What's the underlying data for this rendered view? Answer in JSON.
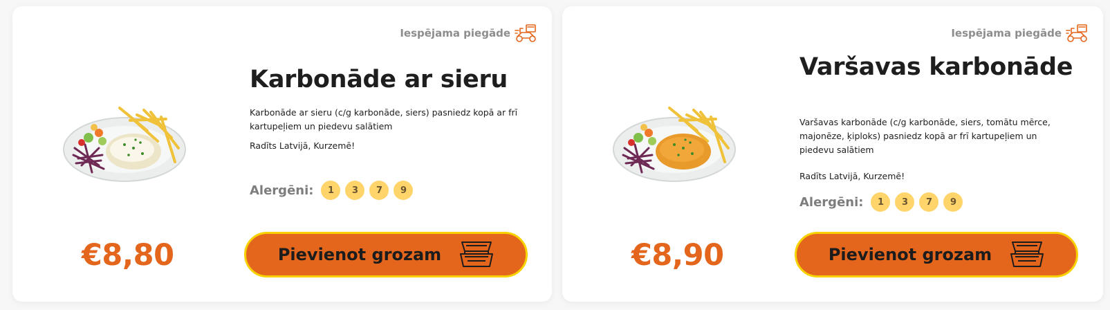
{
  "cards": [
    {
      "delivery": "Iespējama piegāde",
      "title": "Karbonāde ar sieru",
      "description": "Karbonāde ar sieru (c/g karbonāde, siers) pasniedz kopā ar frī kartupeļiem un piedevu salātiem",
      "origin": "Radīts Latvijā, Kurzemē!",
      "allergens_label": "Alergēni:",
      "allergens": [
        "1",
        "3",
        "7",
        "9"
      ],
      "price": "€8,80",
      "cart_button": "Pievienot grozam",
      "icons": {
        "delivery": "delivery-scooter-icon",
        "cart": "food-box-icon"
      }
    },
    {
      "delivery": "Iespējama piegāde",
      "title": "Varšavas karbonāde",
      "description": "Varšavas karbonāde (c/g karbonāde, siers, tomātu mērce, majonēze, ķiploks) pasniedz kopā ar frī kartupeļiem un piedevu salātiem",
      "origin": "Radīts Latvijā, Kurzemē!",
      "allergens_label": "Alergēni:",
      "allergens": [
        "1",
        "3",
        "7",
        "9"
      ],
      "price": "€8,90",
      "cart_button": "Pievienot grozam",
      "icons": {
        "delivery": "delivery-scooter-icon",
        "cart": "food-box-icon"
      }
    }
  ],
  "colors": {
    "accent": "#e4661c",
    "button_border": "#f7d200",
    "badge": "#ffd56b",
    "muted_text": "#8d8d8d"
  }
}
